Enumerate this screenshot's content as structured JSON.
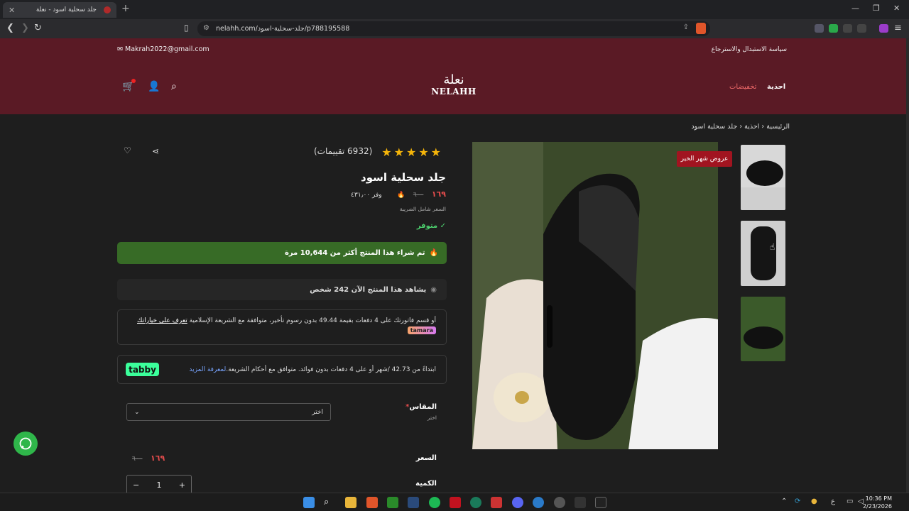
{
  "browser": {
    "tab_title": "جلد سحلية اسود - نعلة",
    "url": "nelahh.com/جلد-سحلية-اسود/p788195588"
  },
  "header": {
    "email": "Makrah2022@gmail.com",
    "policy": "سياسة الاستبدال والاسترجاع",
    "logo_ar": "نعلة",
    "logo_en": "NELAHH",
    "menu": [
      "احذية",
      "تخفيضات"
    ]
  },
  "breadcrumb": [
    "الرئيسية",
    "احذية",
    "جلد سحلية اسود"
  ],
  "product": {
    "badge": "عروض شهر الخير",
    "title": "جلد سحلية اسود",
    "reviews": "(6932 تقييمات)",
    "rating": 5,
    "price": "١٦٩",
    "old_price": "٦٠٠",
    "save": "وفر ٤٣١٫٠٠",
    "tax_note": "السعر شامل الضريبة",
    "stock": "متوفر",
    "bought": "تم شراء هذا المنتج أكثر من 10,644 مرة",
    "viewers": "يشاهد هذا المنتج الآن 242 شخص",
    "tamara_text": "أو قسم فاتورتك على 4 دفعات بقيمة 49.44 بدون رسوم تأخير، متوافقة مع الشريعة الإسلامية",
    "tamara_link": "تعرف على خياراتك",
    "tamara_logo": "tamara",
    "tabby_text": "ابتداءً من 42.73 /شهر أو على 4 دفعات بدون فوائد. متوافق مع أحكام الشريعة.",
    "tabby_link": "لمعرفة المزيد",
    "tabby_logo": "tabby",
    "size_label": "المقاس",
    "size_sub": "اختر",
    "size_select": "اختر",
    "price_label": "السعر",
    "qty_label": "الكمية",
    "qty": "1"
  },
  "taskbar": {
    "time": "10:36 PM",
    "date": "2/23/2026",
    "lang": "ع"
  }
}
